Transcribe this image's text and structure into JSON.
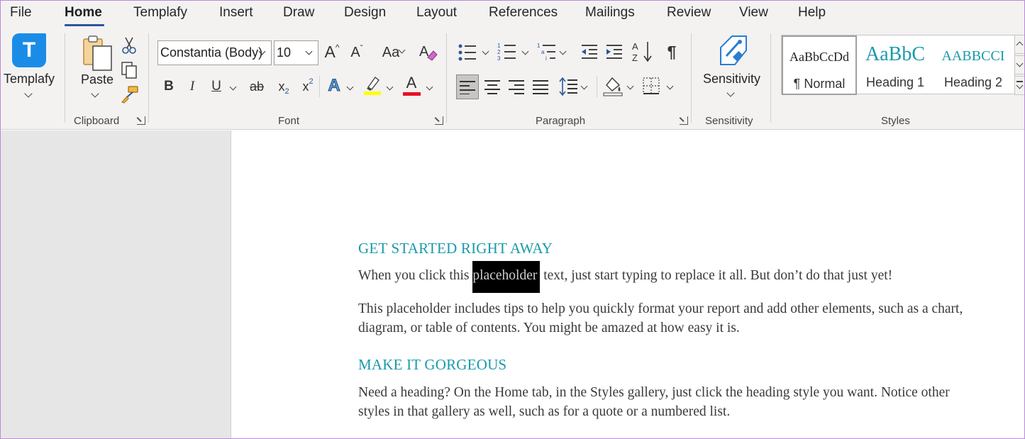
{
  "tabs": [
    "File",
    "Home",
    "Templafy",
    "Insert",
    "Draw",
    "Design",
    "Layout",
    "References",
    "Mailings",
    "Review",
    "View",
    "Help"
  ],
  "active_tab": "Home",
  "ribbon": {
    "templafy": {
      "logo_letter": "T",
      "label": "Templafy"
    },
    "clipboard": {
      "paste_label": "Paste",
      "group_label": "Clipboard"
    },
    "font": {
      "font_name": "Constantia (Body)",
      "font_size": "10",
      "group_label": "Font",
      "bold": "B",
      "italic": "I",
      "underline": "U",
      "strikethrough": "ab",
      "subscript_base": "x",
      "subscript_mark": "2",
      "superscript_base": "x",
      "superscript_mark": "2",
      "effects_letter": "A",
      "font_color_letter": "A",
      "grow_letter": "A",
      "shrink_letter": "A",
      "case_letters": "Aa",
      "highlight_color": "#ffff00",
      "font_color": "#e81123"
    },
    "paragraph": {
      "group_label": "Paragraph",
      "pilcrow": "¶"
    },
    "sensitivity": {
      "label": "Sensitivity",
      "group_label": "Sensitivity"
    },
    "styles": {
      "group_label": "Styles",
      "items": [
        {
          "preview": "AaBbCcDd",
          "name": "¶ Normal"
        },
        {
          "preview": "AaBbC",
          "name": "Heading 1"
        },
        {
          "preview": "AABBCCI",
          "name": "Heading 2"
        }
      ]
    }
  },
  "document": {
    "heading1": "GET STARTED RIGHT AWAY",
    "p1_before": "When you click this ",
    "p1_selected": "placeholder",
    "p1_after": " text, just start typing to replace it all. But don’t do that just yet!",
    "p2": "This placeholder includes tips to help you quickly format your report and add other elements, such as a chart, diagram, or table of contents.  You might be amazed at how easy it is.",
    "heading2": "MAKE IT GORGEOUS",
    "p3": "Need a heading? On the Home tab, in the Styles gallery, just click the heading style you want. Notice other styles in that gallery as well, such as for a quote or a numbered list."
  },
  "colors": {
    "accent": "#2b579a",
    "heading": "#1a9aaa",
    "templafy_blue": "#1a8ce8"
  }
}
